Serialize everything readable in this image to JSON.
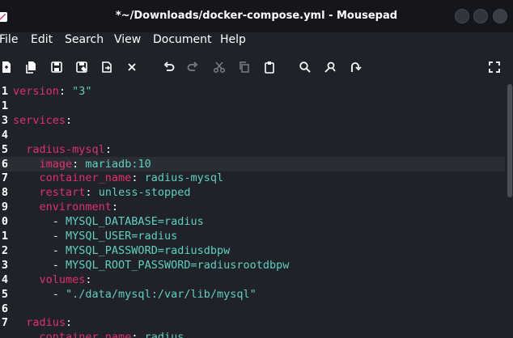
{
  "window": {
    "title": "*~/Downloads/docker-compose.yml - Mousepad"
  },
  "menu": {
    "items": [
      "File",
      "Edit",
      "Search",
      "View",
      "Document",
      "Help"
    ]
  },
  "toolbar": {
    "icons": [
      "new-document-icon",
      "new-window-icon",
      "save-icon",
      "save-as-icon",
      "reload-icon",
      "close-icon",
      "undo-icon",
      "redo-icon",
      "cut-icon",
      "copy-icon",
      "paste-icon",
      "search-icon",
      "find-replace-icon",
      "goto-icon",
      "fullscreen-icon"
    ]
  },
  "editor": {
    "current_line": 6,
    "lines": [
      {
        "n": "1",
        "tokens": [
          [
            "k",
            "version"
          ],
          [
            "p",
            ": "
          ],
          [
            "v",
            "\"3\""
          ]
        ]
      },
      {
        "n": "1",
        "tokens": []
      },
      {
        "n": "3",
        "tokens": [
          [
            "k",
            "services"
          ],
          [
            "p",
            ":"
          ]
        ]
      },
      {
        "n": "4",
        "tokens": []
      },
      {
        "n": "5",
        "tokens": [
          [
            "p",
            "  "
          ],
          [
            "k",
            "radius-mysql"
          ],
          [
            "p",
            ":"
          ]
        ]
      },
      {
        "n": "6",
        "tokens": [
          [
            "p",
            "    "
          ],
          [
            "k",
            "image"
          ],
          [
            "p",
            ": "
          ],
          [
            "v",
            "mariadb:10"
          ]
        ]
      },
      {
        "n": "7",
        "tokens": [
          [
            "p",
            "    "
          ],
          [
            "k",
            "container_name"
          ],
          [
            "p",
            ": "
          ],
          [
            "v",
            "radius-mysql"
          ]
        ]
      },
      {
        "n": "8",
        "tokens": [
          [
            "p",
            "    "
          ],
          [
            "k",
            "restart"
          ],
          [
            "p",
            ": "
          ],
          [
            "v",
            "unless-stopped"
          ]
        ]
      },
      {
        "n": "9",
        "tokens": [
          [
            "p",
            "    "
          ],
          [
            "k",
            "environment"
          ],
          [
            "p",
            ":"
          ]
        ]
      },
      {
        "n": "0",
        "tokens": [
          [
            "p",
            "      - "
          ],
          [
            "v",
            "MYSQL_DATABASE=radius"
          ]
        ]
      },
      {
        "n": "1",
        "tokens": [
          [
            "p",
            "      - "
          ],
          [
            "v",
            "MYSQL_USER=radius"
          ]
        ]
      },
      {
        "n": "2",
        "tokens": [
          [
            "p",
            "      - "
          ],
          [
            "v",
            "MYSQL_PASSWORD=radiusdbpw"
          ]
        ]
      },
      {
        "n": "3",
        "tokens": [
          [
            "p",
            "      - "
          ],
          [
            "v",
            "MYSQL_ROOT_PASSWORD=radiusrootdbpw"
          ]
        ]
      },
      {
        "n": "4",
        "tokens": [
          [
            "p",
            "    "
          ],
          [
            "k",
            "volumes"
          ],
          [
            "p",
            ":"
          ]
        ]
      },
      {
        "n": "5",
        "tokens": [
          [
            "p",
            "      - "
          ],
          [
            "v",
            "\"./data/mysql:/var/lib/mysql\""
          ]
        ]
      },
      {
        "n": "6",
        "tokens": []
      },
      {
        "n": "7",
        "tokens": [
          [
            "p",
            "  "
          ],
          [
            "k",
            "radius"
          ],
          [
            "p",
            ":"
          ]
        ]
      },
      {
        "n": "",
        "tokens": [
          [
            "p",
            "    "
          ],
          [
            "k",
            "container_name"
          ],
          [
            "p",
            ": "
          ],
          [
            "v",
            "radius"
          ]
        ]
      }
    ]
  }
}
